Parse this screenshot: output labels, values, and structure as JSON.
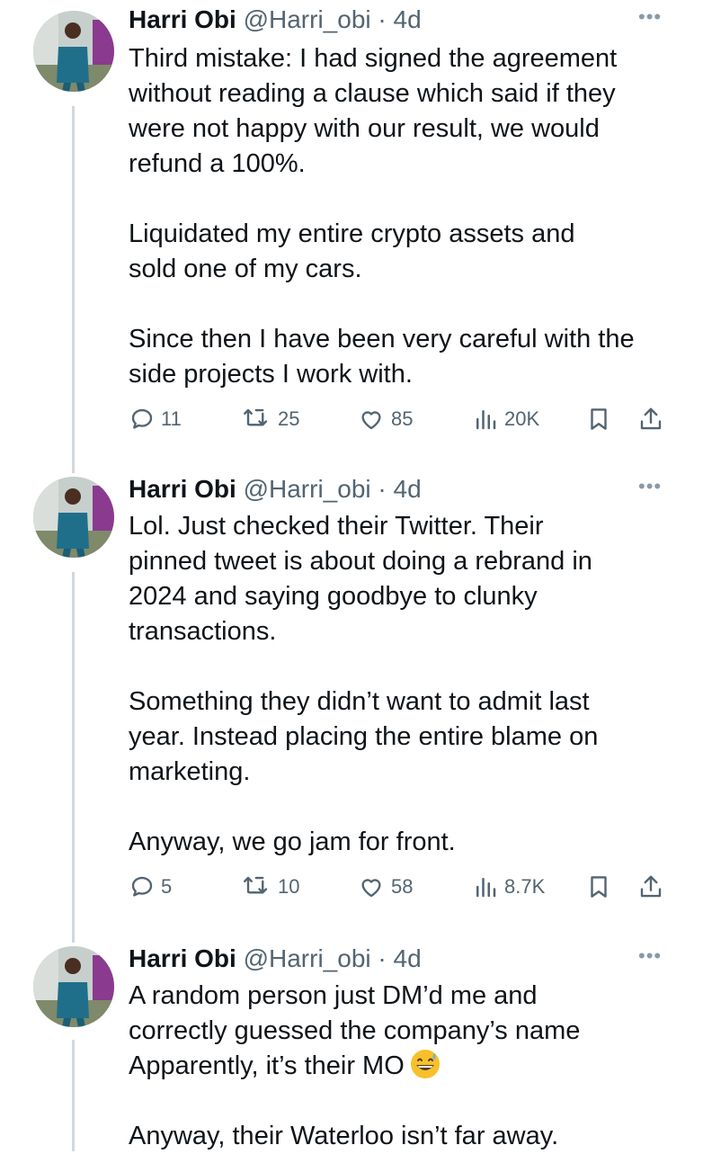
{
  "tweets": [
    {
      "name": "Harri Obi",
      "handle": "@Harri_obi",
      "time": "4d",
      "text": [
        [
          "Third mistake: I had signed the agreement",
          "without reading a clause which said if they",
          "were not happy with our result, we would",
          "refund a 100%."
        ],
        [
          "Liquidated my entire crypto assets and",
          "sold one of my cars."
        ],
        [
          "Since then I have been very careful with the",
          "side projects I work with."
        ]
      ],
      "replies": "11",
      "retweets": "25",
      "likes": "85",
      "views": "20K"
    },
    {
      "name": "Harri Obi",
      "handle": "@Harri_obi",
      "time": "4d",
      "text": [
        [
          "Lol. Just checked their Twitter. Their",
          "pinned tweet is about doing a rebrand in",
          "2024 and saying goodbye to clunky",
          "transactions."
        ],
        [
          "Something they didn’t want to admit last",
          "year. Instead placing the entire blame on",
          "marketing."
        ],
        [
          "Anyway, we go jam for front."
        ]
      ],
      "replies": "5",
      "retweets": "10",
      "likes": "58",
      "views": "8.7K"
    },
    {
      "name": "Harri Obi",
      "handle": "@Harri_obi",
      "time": "4d",
      "text": [
        [
          "A random person just DM’d me and",
          "correctly guessed the company’s name",
          "Apparently, it’s their MO"
        ],
        [
          "Anyway, their Waterloo isn’t far away."
        ]
      ],
      "emoji": "grinning-sweat-emoji"
    }
  ],
  "icons": {
    "reply": "reply-icon",
    "retweet": "retweet-icon",
    "like": "like-icon",
    "views": "views-icon",
    "bookmark": "bookmark-icon",
    "share": "share-icon",
    "more": "more-icon"
  },
  "colors": {
    "text": "#0f1419",
    "secondary": "#536471",
    "thread_line": "#cfd9de"
  }
}
